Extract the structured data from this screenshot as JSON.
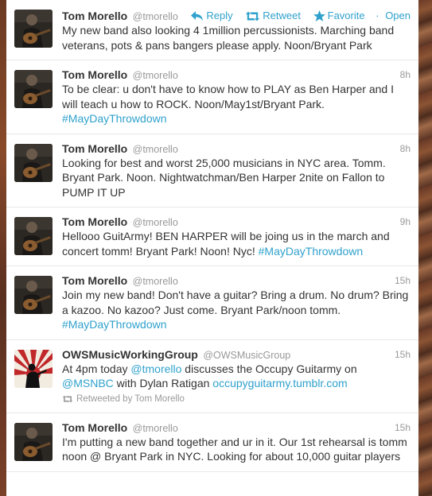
{
  "colors": {
    "link": "#2fa1cc",
    "name": "#333333",
    "muted": "#999999"
  },
  "actions": {
    "reply": "Reply",
    "retweet": "Retweet",
    "favorite": "Favorite",
    "separator": "·",
    "open": "Open"
  },
  "tweets": [
    {
      "name": "Tom Morello",
      "handle": "@tmorello",
      "time": "",
      "text": "My new band also looking 4 1million percussionists. Marching band veterans, pots & pans bangers please apply. Noon/Bryant Park"
    },
    {
      "name": "Tom Morello",
      "handle": "@tmorello",
      "time": "8h",
      "text": "To be clear: u don't have to know how to PLAY as Ben Harper and I will teach u how to ROCK. Noon/May1st/Bryant Park.",
      "hashtag": "#MayDayThrowdown"
    },
    {
      "name": "Tom Morello",
      "handle": "@tmorello",
      "time": "8h",
      "text": "Looking for best and worst 25,000 musicians in NYC area. Tomm. Bryant Park. Noon. Nightwatchman/Ben Harper 2nite on Fallon to PUMP IT UP"
    },
    {
      "name": "Tom Morello",
      "handle": "@tmorello",
      "time": "9h",
      "text": "Hellooo GuitArmy! BEN HARPER will be joing us in the march and concert tomm! Bryant Park! Noon! Nyc!",
      "hashtag": "#MayDayThrowdown"
    },
    {
      "name": "Tom Morello",
      "handle": "@tmorello",
      "time": "15h",
      "text": "Join my new band! Don't have a guitar? Bring a drum. No drum? Bring a kazoo. No kazoo? Just come. Bryant Park/noon tomm.",
      "hashtag": "#MayDayThrowdown"
    },
    {
      "name": "OWSMusicWorkingGroup",
      "handle": "@OWSMusicGroup",
      "time": "15h",
      "text_a": "At 4pm today",
      "mention_a": "@tmorello",
      "text_b": "discusses the Occupy Guitarmy on",
      "mention_b": "@MSNBC",
      "text_c": "with Dylan Ratigan",
      "link": "occupyguitarmy.tumblr.com",
      "retweeted_by": "Retweeted by Tom Morello"
    },
    {
      "name": "Tom Morello",
      "handle": "@tmorello",
      "time": "15h",
      "text": "I'm putting a new band together and ur in it. Our 1st rehearsal is tomm noon @ Bryant Park in NYC. Looking for about 10,000 guitar players"
    }
  ]
}
